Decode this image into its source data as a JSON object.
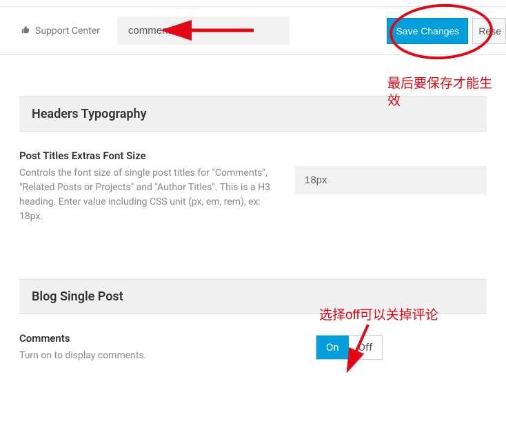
{
  "header": {
    "support_label": "Support Center",
    "search_value": "comment",
    "save_label": "Save Changes",
    "reset_label": "Rese"
  },
  "sections": {
    "headers_typography": {
      "title": "Headers Typography",
      "setting": {
        "title": "Post Titles Extras Font Size",
        "desc": "Controls the font size of single post titles for \"Comments\", \"Related Posts or Projects\" and \"Author Titles\". This is a H3 heading. Enter value including CSS unit (px, em, rem), ex: 18px.",
        "value": "18px"
      }
    },
    "blog_single_post": {
      "title": "Blog Single Post",
      "setting": {
        "title": "Comments",
        "desc": "Turn on to display comments.",
        "on": "On",
        "off": "Off"
      }
    }
  },
  "annotations": {
    "save_note": "最后要保存才能生效",
    "off_note": "选择off可以关掉评论"
  }
}
